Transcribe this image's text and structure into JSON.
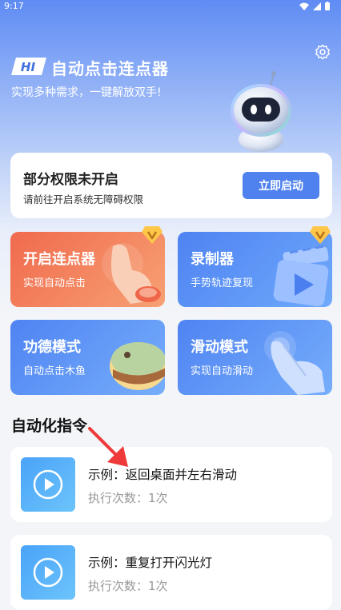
{
  "status_bar": {
    "time": "9:17"
  },
  "header": {
    "badge": "HI",
    "title": "自动点击连点器",
    "subtitle": "实现多种需求，一键解放双手!"
  },
  "permission": {
    "title": "部分权限未开启",
    "desc": "请前往开启系统无障碍权限",
    "button": "立即启动"
  },
  "tiles": [
    {
      "title": "开启连点器",
      "subtitle": "实现自动点击"
    },
    {
      "title": "录制器",
      "subtitle": "手势轨迹复现"
    },
    {
      "title": "功德模式",
      "subtitle": "自动点击木鱼"
    },
    {
      "title": "滑动模式",
      "subtitle": "实现自动滑动"
    }
  ],
  "section_title": "自动化指令",
  "commands": [
    {
      "name": "示例：返回桌面并左右滑动",
      "count": "执行次数：1次"
    },
    {
      "name": "示例：重复打开闪光灯",
      "count": "执行次数：1次"
    }
  ],
  "colors": {
    "accent": "#4f82ef",
    "orange_tile": "#f07a55",
    "blue_tile": "#5b8ff6"
  }
}
